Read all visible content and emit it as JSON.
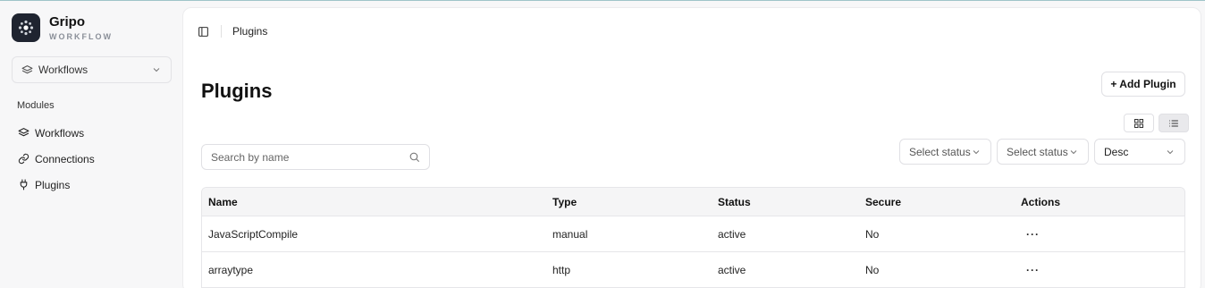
{
  "brand": {
    "name": "Gripo",
    "subtitle": "WORKFLOW"
  },
  "workspace_select": {
    "value": "Workflows",
    "icon": "layers-icon"
  },
  "sidebar": {
    "section_label": "Modules",
    "items": [
      {
        "label": "Workflows",
        "icon": "layers-icon"
      },
      {
        "label": "Connections",
        "icon": "link-icon"
      },
      {
        "label": "Plugins",
        "icon": "plug-icon"
      }
    ]
  },
  "breadcrumb": {
    "current": "Plugins"
  },
  "page": {
    "title": "Plugins",
    "add_button": "+ Add Plugin"
  },
  "search": {
    "placeholder": "Search by name"
  },
  "filters": {
    "status1": "Select status",
    "status2": "Select status",
    "sort": "Desc"
  },
  "table": {
    "headers": [
      "Name",
      "Type",
      "Status",
      "Secure",
      "Actions"
    ],
    "rows": [
      {
        "name": "JavaScriptCompile",
        "type": "manual",
        "status": "active",
        "secure": "No",
        "actions": "···"
      },
      {
        "name": "arraytype",
        "type": "http",
        "status": "active",
        "secure": "No",
        "actions": "···"
      }
    ]
  }
}
